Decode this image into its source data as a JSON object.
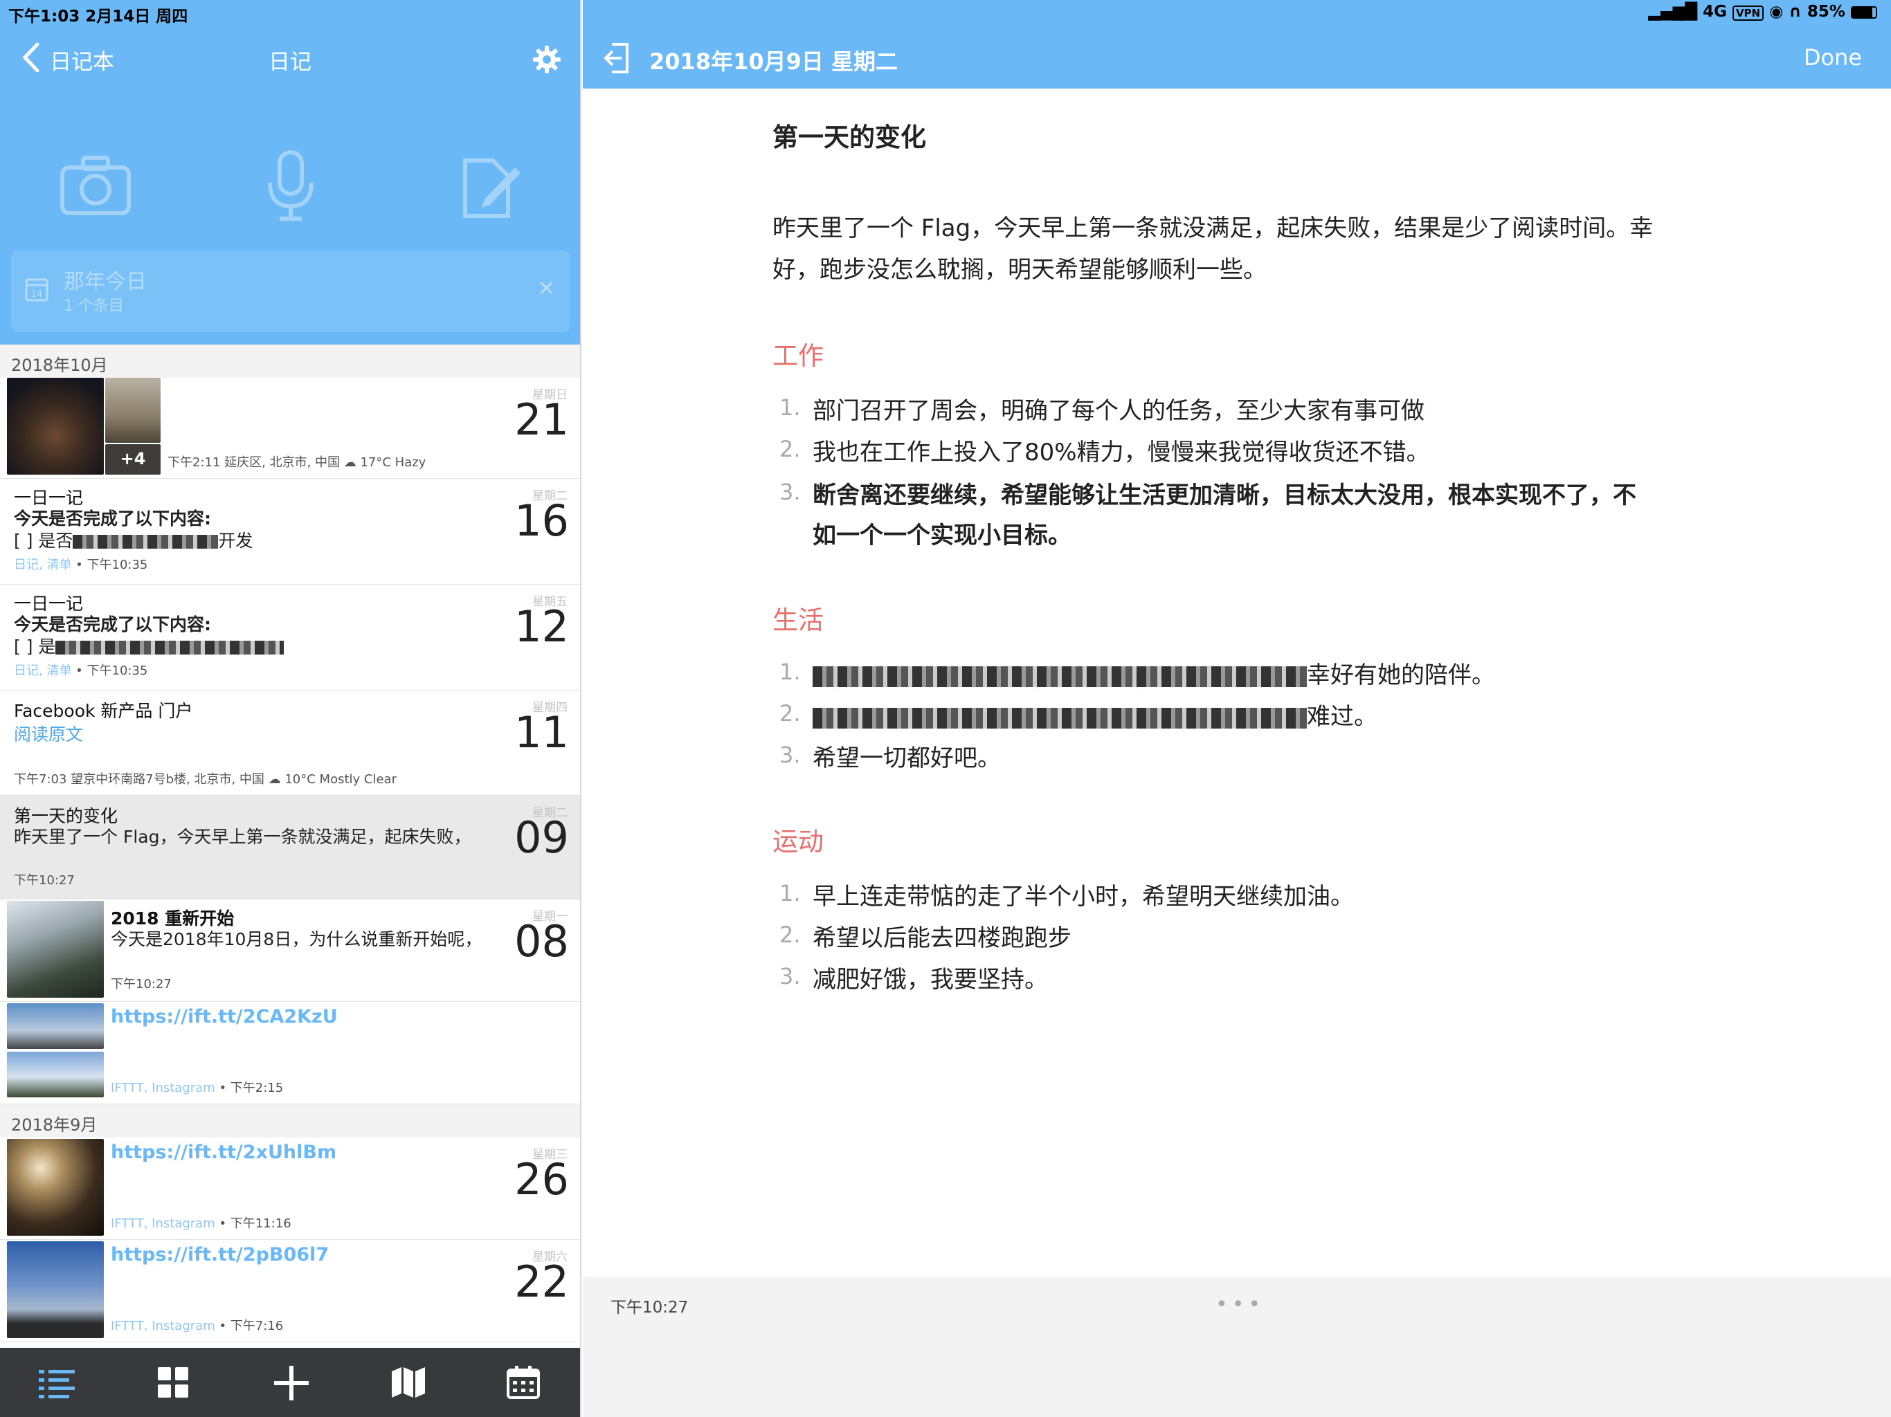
{
  "status": {
    "time_date": "下午1:03   2月14日 周四",
    "network": "4G",
    "vpn": "VPN",
    "battery": "85%"
  },
  "left_nav": {
    "back_label": "日记本",
    "title": "日记"
  },
  "on_this_day": {
    "title": "那年今日",
    "subtitle": "1 个条目",
    "icon_day": "14"
  },
  "months": [
    "2018年10月",
    "2018年9月"
  ],
  "entries": [
    {
      "weekday": "星期日",
      "day": "21",
      "more": "+4",
      "meta": "下午2:11   延庆区, 北京市, 中国  ☁ 17°C Hazy"
    },
    {
      "weekday": "星期二",
      "day": "16",
      "title": "一日一记",
      "line1": "今天是否完成了以下内容:",
      "line2": "[ ] 是否",
      "line2_end": "开发",
      "tags": "日记, 清单",
      "time": "下午10:35"
    },
    {
      "weekday": "星期五",
      "day": "12",
      "title": "一日一记",
      "line1": "今天是否完成了以下内容:",
      "line2": "[ ] 是",
      "tags": "日记, 清单",
      "time": "下午10:35"
    },
    {
      "weekday": "星期四",
      "day": "11",
      "title": "Facebook 新产品 门户",
      "link": "阅读原文",
      "meta": "下午7:03   望京中环南路7号b楼, 北京市, 中国  ☁ 10°C Mostly Clear"
    },
    {
      "weekday": "星期二",
      "day": "09",
      "title": "第一天的变化",
      "line1": "昨天里了一个 Flag，今天早上第一条就没满足，起床失败，",
      "time": "下午10:27"
    },
    {
      "weekday": "星期一",
      "day": "08",
      "title": "2018 重新开始",
      "line1": "今天是2018年10月8日，为什么说重新开始呢，",
      "time": "下午10:27"
    },
    {
      "link": "https://ift.tt/2CA2KzU",
      "tags": "IFTTT, Instagram",
      "time": "下午2:15"
    },
    {
      "weekday": "星期三",
      "day": "26",
      "link": "https://ift.tt/2xUhlBm",
      "tags": "IFTTT, Instagram",
      "time": "下午11:16"
    },
    {
      "weekday": "星期六",
      "day": "22",
      "link": "https://ift.tt/2pB06l7",
      "tags": "IFTTT, Instagram",
      "time": "下午7:16"
    }
  ],
  "detail": {
    "date_title": "2018年10月9日 星期二",
    "done_label": "Done",
    "heading": "第一天的变化",
    "intro_l1": "昨天里了一个 Flag，今天早上第一条就没满足，起床失败，结果是少了阅读时间。幸",
    "intro_l2": "好，跑步没怎么耽搁，明天希望能够顺利一些。",
    "sections": [
      {
        "title": "工作",
        "items": [
          "部门召开了周会，明确了每个人的任务，至少大家有事可做",
          "我也在工作上投入了80%精力，慢慢来我觉得收货还不错。",
          "断舍离还要继续，希望能够让生活更加清晰，目标太大没用，根本实现不了，不",
          "如一个一个实现小目标。"
        ]
      },
      {
        "title": "生活",
        "items": [
          "幸好有她的陪伴。",
          "难过。",
          "希望一切都好吧。"
        ]
      },
      {
        "title": "运动",
        "items": [
          "早上连走带惦的走了半个小时，希望明天继续加油。",
          "希望以后能去四楼跑跑步",
          "减肥好饿，我要坚持。"
        ]
      }
    ],
    "footer_time": "下午10:27"
  },
  "colors": {
    "accent": "#6ab8f6",
    "section": "#e8706c",
    "tabbar": "#37393d"
  }
}
